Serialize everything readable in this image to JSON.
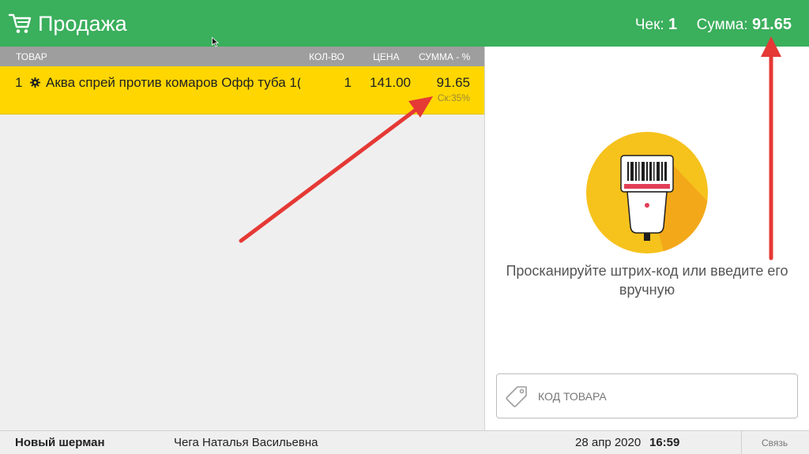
{
  "header": {
    "title": "Продажа",
    "check_label": "Чек:",
    "check_number": "1",
    "sum_label": "Сумма:",
    "sum_value": "91.65",
    "color": "#3aaf5c",
    "icon": "cart-icon"
  },
  "table": {
    "columns": {
      "name": "ТОВАР",
      "qty": "КОЛ-ВО",
      "price": "ЦЕНА",
      "sum": "СУММА - %"
    },
    "rows": [
      {
        "index": "1",
        "icon": "gear-icon",
        "name": "Аква спрей против комаров Офф туба 1(",
        "qty": "1",
        "price": "141.00",
        "sum": "91.65",
        "discount": "Ск:35%"
      }
    ],
    "highlight_color": "#ffd600"
  },
  "scanner": {
    "icon": "barcode-scanner-icon",
    "prompt": "Просканируйте штрих-код или введите его вручную"
  },
  "code_input": {
    "value": "",
    "placeholder": "КОД ТОВАРА",
    "icon": "tag-icon"
  },
  "statusbar": {
    "store": "Новый шерман",
    "cashier": "Чега Наталья Васильевна",
    "date": "28 апр 2020",
    "time": "16:59",
    "link": "Связь"
  },
  "annotations": {
    "arrow_color": "#e53935"
  }
}
